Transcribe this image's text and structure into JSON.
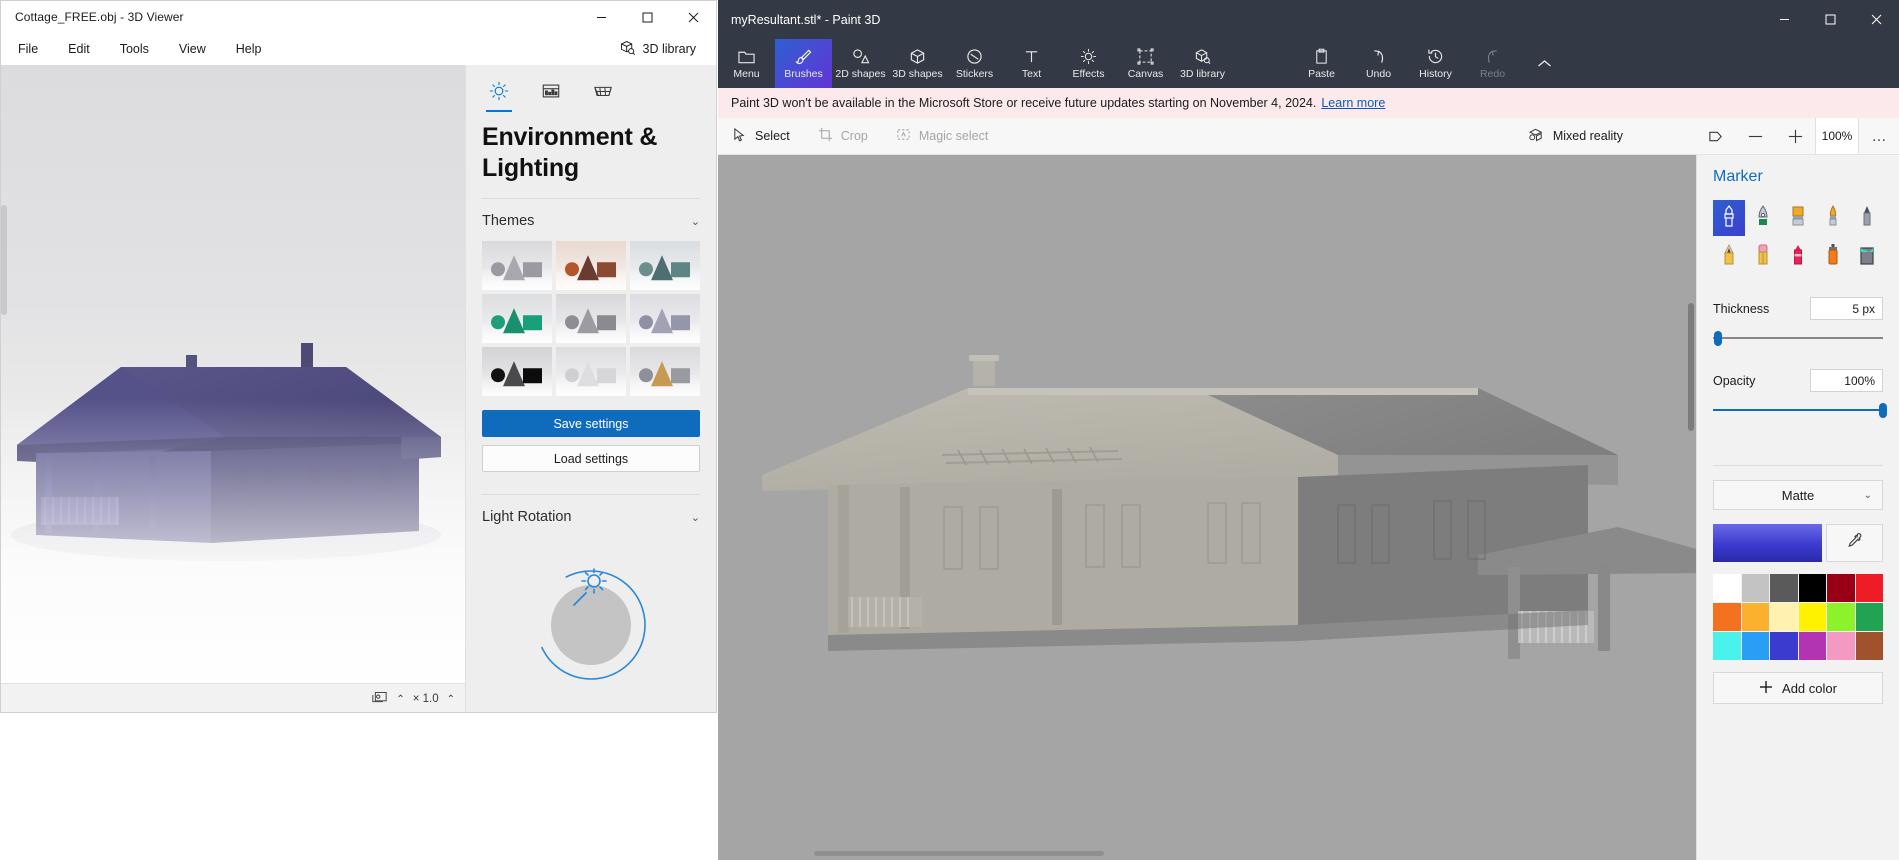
{
  "viewer": {
    "title": "Cottage_FREE.obj - 3D Viewer",
    "window_controls": {
      "minimize": "─",
      "maximize": "☐",
      "close": "✕"
    },
    "menu": [
      "File",
      "Edit",
      "Tools",
      "View",
      "Help"
    ],
    "library_button": "3D library",
    "tabs": [
      {
        "name": "lighting-tab",
        "icon": "sun-icon",
        "active": true
      },
      {
        "name": "visual-effects-tab",
        "icon": "image-icon",
        "active": false
      },
      {
        "name": "wireframe-tab",
        "icon": "grid-icon",
        "active": false
      }
    ],
    "heading": "Environment & Lighting",
    "themes": {
      "label": "Themes",
      "chevron": "⌄",
      "cells": [
        {
          "name": "theme-grey-studio",
          "shape": "#9a9aa0",
          "cone": "#a8a8ae",
          "cube": "#9a9aa0",
          "bg_top": "#d9d9db",
          "bg_bottom": "#f4f4f5"
        },
        {
          "name": "theme-sunset",
          "shape": "#b5552a",
          "cone": "#6a3b30",
          "cube": "#8c4a33",
          "bg_top": "#e8d9d2",
          "bg_bottom": "#fbf3ee"
        },
        {
          "name": "theme-teal-studio",
          "shape": "#6b8f8f",
          "cone": "#4d6f72",
          "cube": "#5e8486",
          "bg_top": "#dadde0",
          "bg_bottom": "#f3f4f5"
        },
        {
          "name": "theme-green",
          "shape": "#1f9e79",
          "cone": "#1a8f6d",
          "cube": "#17a07a",
          "bg_top": "#dcdee0",
          "bg_bottom": "#f4f4f5"
        },
        {
          "name": "theme-neutral-grey",
          "shape": "#8d8d93",
          "cone": "#9b9ba1",
          "cube": "#8a8a90",
          "bg_top": "#d8d8da",
          "bg_bottom": "#f2f2f3"
        },
        {
          "name": "theme-lavender",
          "shape": "#8f8fa6",
          "cone": "#a2a2b6",
          "cube": "#9595ab",
          "bg_top": "#dcdce2",
          "bg_bottom": "#f4f4f6"
        },
        {
          "name": "theme-dark",
          "shape": "#111111",
          "cone": "#4a4a4d",
          "cube": "#0c0c0c",
          "bg_top": "#d3d3d5",
          "bg_bottom": "#f0f0f1"
        },
        {
          "name": "theme-white",
          "shape": "#cfcfd2",
          "cone": "#dedee1",
          "cube": "#d6d6d9",
          "bg_top": "#dddddf",
          "bg_bottom": "#f6f6f7"
        },
        {
          "name": "theme-gold",
          "shape": "#8f8f99",
          "cone": "#c79a54",
          "cube": "#9a9aa2",
          "bg_top": "#dadadd",
          "bg_bottom": "#f3f3f4"
        }
      ]
    },
    "save_settings": "Save settings",
    "load_settings": "Load settings",
    "light_rotation": {
      "label": "Light Rotation",
      "chevron": "⌄",
      "sun_icon": "sun-icon"
    },
    "status": {
      "animation_icon": "animation-icon",
      "chevron_up": "⌃",
      "speed": "× 1.0",
      "speed_chevron": "⌃"
    }
  },
  "paint": {
    "title": "myResultant.stl* - Paint 3D",
    "window_controls": {
      "minimize": "─",
      "maximize": "☐",
      "close": "✕"
    },
    "toolbar": [
      {
        "name": "menu-button",
        "label": "Menu",
        "icon": "folder-icon",
        "active": false,
        "disabled": false
      },
      {
        "name": "brushes-button",
        "label": "Brushes",
        "icon": "brush-icon",
        "active": true,
        "disabled": false
      },
      {
        "name": "shapes2d-button",
        "label": "2D shapes",
        "icon": "shapes2d-icon",
        "active": false,
        "disabled": false
      },
      {
        "name": "shapes3d-button",
        "label": "3D shapes",
        "icon": "cube-icon",
        "active": false,
        "disabled": false
      },
      {
        "name": "stickers-button",
        "label": "Stickers",
        "icon": "sticker-icon",
        "active": false,
        "disabled": false
      },
      {
        "name": "text-button",
        "label": "Text",
        "icon": "text-icon",
        "active": false,
        "disabled": false
      },
      {
        "name": "effects-button",
        "label": "Effects",
        "icon": "effects-icon",
        "active": false,
        "disabled": false
      },
      {
        "name": "canvas-button",
        "label": "Canvas",
        "icon": "canvas-icon",
        "active": false,
        "disabled": false
      },
      {
        "name": "library3d-button",
        "label": "3D library",
        "icon": "library3d-icon",
        "active": false,
        "disabled": false
      }
    ],
    "toolbar_right": [
      {
        "name": "paste-button",
        "label": "Paste",
        "icon": "clipboard-icon",
        "disabled": false
      },
      {
        "name": "undo-button",
        "label": "Undo",
        "icon": "undo-icon",
        "disabled": false
      },
      {
        "name": "history-button",
        "label": "History",
        "icon": "history-icon",
        "disabled": false
      },
      {
        "name": "redo-button",
        "label": "Redo",
        "icon": "redo-icon",
        "disabled": true
      }
    ],
    "collapse_chevron": "⌃",
    "banner": {
      "text": "Paint 3D won't be available in the Microsoft Store or receive future updates starting on November 4, 2024.",
      "link": "Learn more"
    },
    "subtoolbar": [
      {
        "name": "select-tool",
        "label": "Select",
        "icon": "cursor-icon",
        "disabled": false
      },
      {
        "name": "crop-tool",
        "label": "Crop",
        "icon": "crop-icon",
        "disabled": true
      },
      {
        "name": "magic-select-tool",
        "label": "Magic select",
        "icon": "magic-select-icon",
        "disabled": true
      },
      {
        "name": "mixed-reality-tool",
        "label": "Mixed reality",
        "icon": "mixed-reality-icon",
        "disabled": false
      }
    ],
    "view_icon": "view-3d-icon",
    "zoom_out": "─",
    "zoom_in": "＋",
    "zoom_level": "100%",
    "more_options": "…",
    "marker": {
      "title": "Marker",
      "brushes": [
        {
          "name": "marker-brush",
          "icon": "marker-icon",
          "active": true
        },
        {
          "name": "calligraphy-pen",
          "icon": "fountain-pen-icon",
          "active": false
        },
        {
          "name": "oil-brush",
          "icon": "flat-brush-icon",
          "active": false
        },
        {
          "name": "watercolor-brush",
          "icon": "round-brush-icon",
          "active": false
        },
        {
          "name": "pixel-pen",
          "icon": "pixel-pen-icon",
          "active": false
        },
        {
          "name": "pencil",
          "icon": "pencil-icon",
          "active": false
        },
        {
          "name": "eraser",
          "icon": "eraser-icon",
          "active": false
        },
        {
          "name": "crayon",
          "icon": "crayon-icon",
          "active": false
        },
        {
          "name": "spray-can",
          "icon": "spray-can-icon",
          "active": false
        },
        {
          "name": "fill-bucket",
          "icon": "paint-bucket-icon",
          "active": false
        }
      ],
      "thickness": {
        "label": "Thickness",
        "value": "5 px",
        "percent": 3
      },
      "opacity": {
        "label": "Opacity",
        "value": "100%",
        "percent": 100
      },
      "material": {
        "value": "Matte",
        "chevron": "⌄"
      },
      "current_color": "#3b3bd0",
      "eyedropper_icon": "eyedropper-icon",
      "palette": [
        "#ffffff",
        "#c3c3c3",
        "#5a5a5a",
        "#000000",
        "#9a0015",
        "#ee1c25",
        "#f3711f",
        "#fbb12e",
        "#fff2b0",
        "#fff200",
        "#8cf22a",
        "#20a352",
        "#49f2eb",
        "#2a9df4",
        "#3b3bd0",
        "#b234b3",
        "#f49ac2",
        "#a0522d"
      ],
      "add_color": {
        "label": "Add color",
        "icon": "plus-icon"
      }
    }
  }
}
